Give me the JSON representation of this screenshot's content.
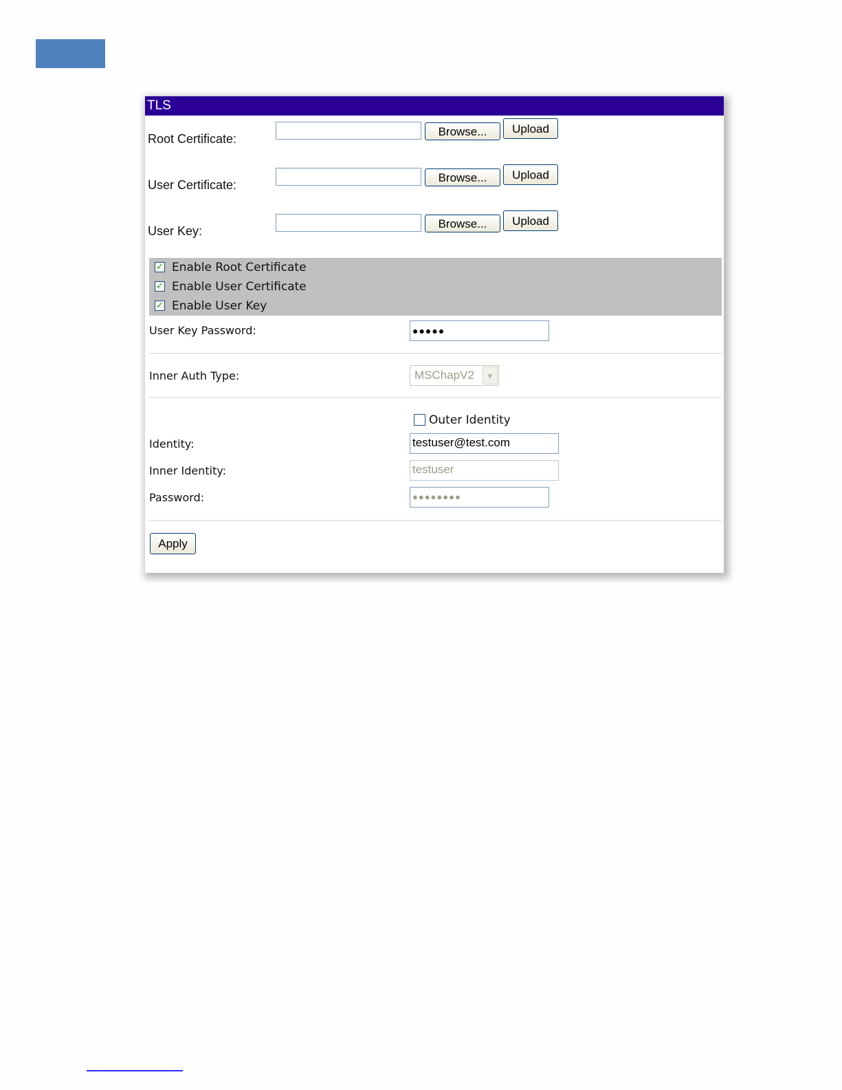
{
  "colors": {
    "title_bar": "#2a0097",
    "accent_block": "#4f81bd",
    "check_band": "#c0c0c0",
    "disabled_text": "#9b9b88",
    "footer_link": "#2b2bff"
  },
  "panel": {
    "title": "TLS",
    "certificates": [
      {
        "label": "Root Certificate:",
        "browse_label": "Browse...",
        "upload_label": "Upload"
      },
      {
        "label": "User Certificate:",
        "browse_label": "Browse...",
        "upload_label": "Upload"
      },
      {
        "label": "User Key:",
        "browse_label": "Browse...",
        "upload_label": "Upload"
      }
    ],
    "enable_options": [
      {
        "label": "Enable Root Certificate",
        "checked": true
      },
      {
        "label": "Enable User Certificate",
        "checked": true
      },
      {
        "label": "Enable User Key",
        "checked": true
      }
    ],
    "user_key_password": {
      "label": "User Key Password:",
      "value": "●●●●●"
    },
    "inner_auth_type": {
      "label": "Inner Auth Type:",
      "selected": "MSChapV2",
      "disabled": true
    },
    "outer_identity": {
      "label": "Outer Identity",
      "checked": false
    },
    "identity": {
      "label": "Identity:",
      "value": "testuser@test.com"
    },
    "inner_identity": {
      "label": "Inner Identity:",
      "value": "testuser",
      "disabled": true
    },
    "password": {
      "label": "Password:",
      "value": "●●●●●●●●",
      "disabled": true
    },
    "apply_label": "Apply"
  }
}
